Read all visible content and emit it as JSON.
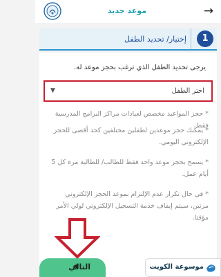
{
  "header": {
    "title": "موعد جديد",
    "back_icon": "arrow-right-icon"
  },
  "step": {
    "number": "1",
    "label": "إختيار/ تحديد الطفل"
  },
  "form": {
    "instruction": "يرجى تحديد الطفل الذي ترغب بحجز موعد له.",
    "select_value": "اختر الطفل"
  },
  "notes": [
    "* حجز المواعيد مخصص لعيادات مراكز البرامج المدرسية فقط.",
    "* يمكنك حجز موعدين لطفلين مختلفين كحد أقصى للحجز الإلكتروني اليومي.",
    "* يسمح بحجز موعد واحد فقط للطالب/ للطالبة مرة كل 5 أيام عمل.",
    "* في حال تكرار عدم الإلتزام بموعد الحجز الإلكتروني مرتين، سيتم إيقاف خدمة التسجيل الإلكتروني لولي الأمر مؤقتا."
  ],
  "next_button": {
    "label": "التالي"
  },
  "watermark": {
    "text": "موسوعة الكويت"
  },
  "colors": {
    "accent": "#1a9fb0",
    "step_blue": "#1f4e9b",
    "highlight_red": "#c8202f",
    "next_green": "#4fc48c"
  }
}
